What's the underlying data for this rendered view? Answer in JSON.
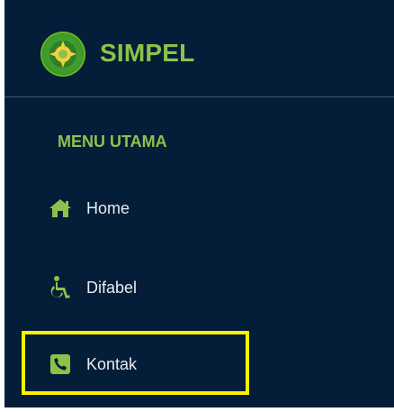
{
  "brand": {
    "name": "SIMPEL",
    "logo_icon": "court-emblem-icon"
  },
  "menu": {
    "section_title": "MENU UTAMA",
    "items": [
      {
        "label": "Home",
        "icon": "home-icon"
      },
      {
        "label": "Difabel",
        "icon": "wheelchair-icon"
      },
      {
        "label": "Kontak",
        "icon": "phone-square-icon"
      }
    ]
  },
  "colors": {
    "sidebar_bg": "#041d38",
    "accent_green": "#8bc34a",
    "menu_text": "#e8ecef",
    "highlight": "#fff200"
  }
}
